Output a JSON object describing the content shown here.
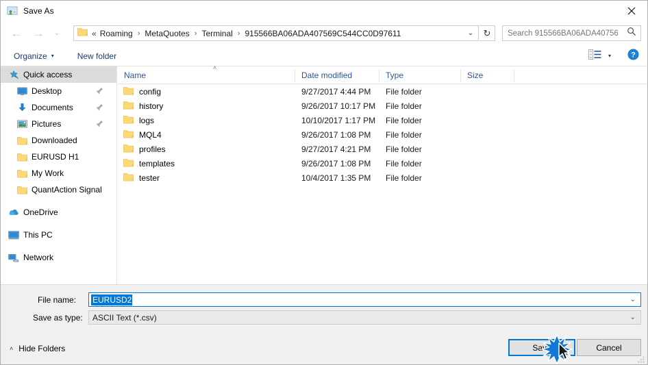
{
  "window": {
    "title": "Save As",
    "icon": "save-as-icon",
    "close_label": "✕"
  },
  "nav": {
    "back": "←",
    "forward": "→",
    "recent": "⌄",
    "up": "↑",
    "refresh": "↻",
    "breadcrumb_prefix": "«",
    "breadcrumbs": [
      "Roaming",
      "MetaQuotes",
      "Terminal",
      "915566BA06ADA407569C544CC0D97611"
    ],
    "separator": "›",
    "dropdown_caret": "⌄"
  },
  "search": {
    "placeholder": "Search 915566BA06ADA40756...",
    "value": "",
    "icon": "search-icon"
  },
  "toolbar": {
    "organize_label": "Organize",
    "new_folder_label": "New folder",
    "caret": "▾",
    "view_icon": "list-view-icon",
    "view_caret": "▾",
    "help_label": "?"
  },
  "sidebar": {
    "items": [
      {
        "label": "Quick access",
        "icon": "star-pin-icon",
        "level": 0,
        "selected": true,
        "pinned": false
      },
      {
        "label": "Desktop",
        "icon": "desktop-icon",
        "level": 1,
        "selected": false,
        "pinned": true
      },
      {
        "label": "Documents",
        "icon": "documents-icon",
        "level": 1,
        "selected": false,
        "pinned": true
      },
      {
        "label": "Pictures",
        "icon": "pictures-icon",
        "level": 1,
        "selected": false,
        "pinned": true
      },
      {
        "label": "Downloaded",
        "icon": "folder-icon",
        "level": 1,
        "selected": false,
        "pinned": false
      },
      {
        "label": "EURUSD H1",
        "icon": "folder-icon",
        "level": 1,
        "selected": false,
        "pinned": false
      },
      {
        "label": "My Work",
        "icon": "folder-icon",
        "level": 1,
        "selected": false,
        "pinned": false
      },
      {
        "label": "QuantAction Signal",
        "icon": "folder-icon",
        "level": 1,
        "selected": false,
        "pinned": false
      },
      {
        "label": "OneDrive",
        "icon": "onedrive-icon",
        "level": 0,
        "selected": false,
        "pinned": false,
        "gap_before": true
      },
      {
        "label": "This PC",
        "icon": "thispc-icon",
        "level": 0,
        "selected": false,
        "pinned": false,
        "gap_before": true
      },
      {
        "label": "Network",
        "icon": "network-icon",
        "level": 0,
        "selected": false,
        "pinned": false,
        "gap_before": true
      }
    ]
  },
  "filelist": {
    "columns": [
      "Name",
      "Date modified",
      "Type",
      "Size"
    ],
    "sort_column": "Name",
    "sort_direction": "ascending",
    "sort_indicator": "˄",
    "rows": [
      {
        "name": "config",
        "date_modified": "9/27/2017 4:44 PM",
        "type": "File folder",
        "size": ""
      },
      {
        "name": "history",
        "date_modified": "9/26/2017 10:17 PM",
        "type": "File folder",
        "size": ""
      },
      {
        "name": "logs",
        "date_modified": "10/10/2017 1:17 PM",
        "type": "File folder",
        "size": ""
      },
      {
        "name": "MQL4",
        "date_modified": "9/26/2017 1:08 PM",
        "type": "File folder",
        "size": ""
      },
      {
        "name": "profiles",
        "date_modified": "9/27/2017 4:21 PM",
        "type": "File folder",
        "size": ""
      },
      {
        "name": "templates",
        "date_modified": "9/26/2017 1:08 PM",
        "type": "File folder",
        "size": ""
      },
      {
        "name": "tester",
        "date_modified": "10/4/2017 1:35 PM",
        "type": "File folder",
        "size": ""
      }
    ]
  },
  "form": {
    "filename_label": "File name:",
    "filename_value": "EURUSD2",
    "filename_selected": true,
    "savetype_label": "Save as type:",
    "savetype_value": "ASCII Text (*.csv)",
    "dropdown_caret": "⌄"
  },
  "footer": {
    "hide_folders_label": "Hide Folders",
    "hide_folders_caret": "˄",
    "save_label": "Save",
    "cancel_label": "Cancel",
    "focused_button": "Save"
  },
  "colors": {
    "accent": "#0078d7",
    "selection": "#0078d7",
    "column_header_text": "#2b5797",
    "toolbar_text": "#1b3a6b",
    "folder_yellow": "#fcd975",
    "dialog_chrome": "#f0f0f0",
    "sidebar_selected": "#dcdcdc"
  }
}
